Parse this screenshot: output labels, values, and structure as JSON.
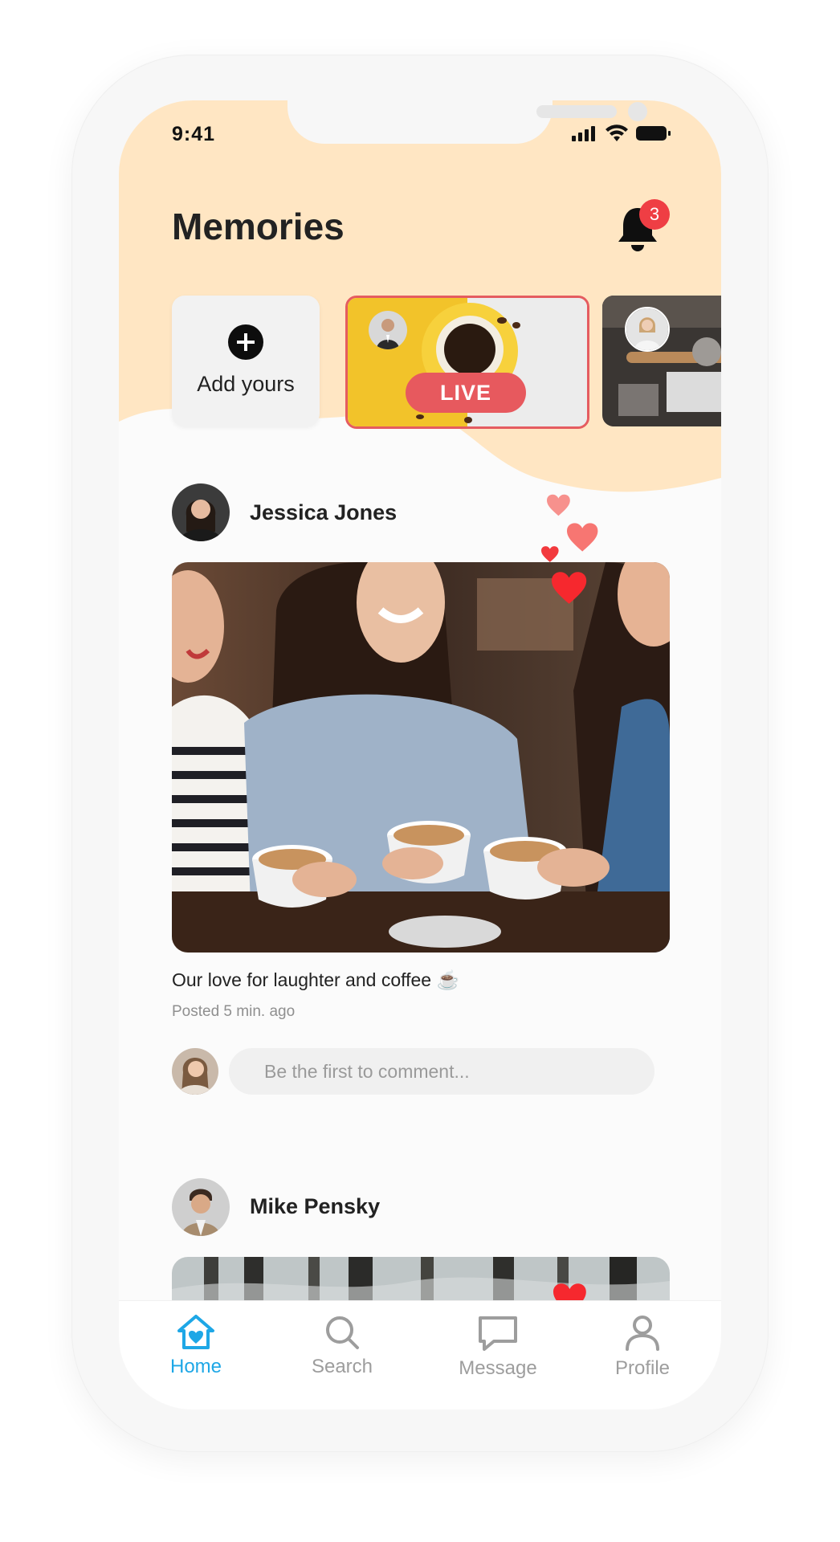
{
  "status_bar": {
    "time": "9:41"
  },
  "header": {
    "title": "Memories",
    "notification_count": "3"
  },
  "stories": {
    "add_label": "Add yours",
    "live_label": "LIVE"
  },
  "posts": [
    {
      "author": "Jessica Jones",
      "caption": "Our love for laughter and coffee ☕",
      "posted": "Posted 5 min. ago",
      "comment_placeholder": "Be the first to comment..."
    },
    {
      "author": "Mike Pensky"
    }
  ],
  "tabbar": {
    "items": [
      {
        "label": "Home",
        "icon": "home-icon",
        "active": true
      },
      {
        "label": "Search",
        "icon": "search-icon",
        "active": false
      },
      {
        "label": "Message",
        "icon": "message-icon",
        "active": false
      },
      {
        "label": "Profile",
        "icon": "profile-icon",
        "active": false
      }
    ]
  },
  "colors": {
    "header_bg": "#ffe6c3",
    "accent": "#1ea7e6",
    "live": "#e7595e",
    "badge": "#ef3e44",
    "heart": "#f6282e"
  }
}
